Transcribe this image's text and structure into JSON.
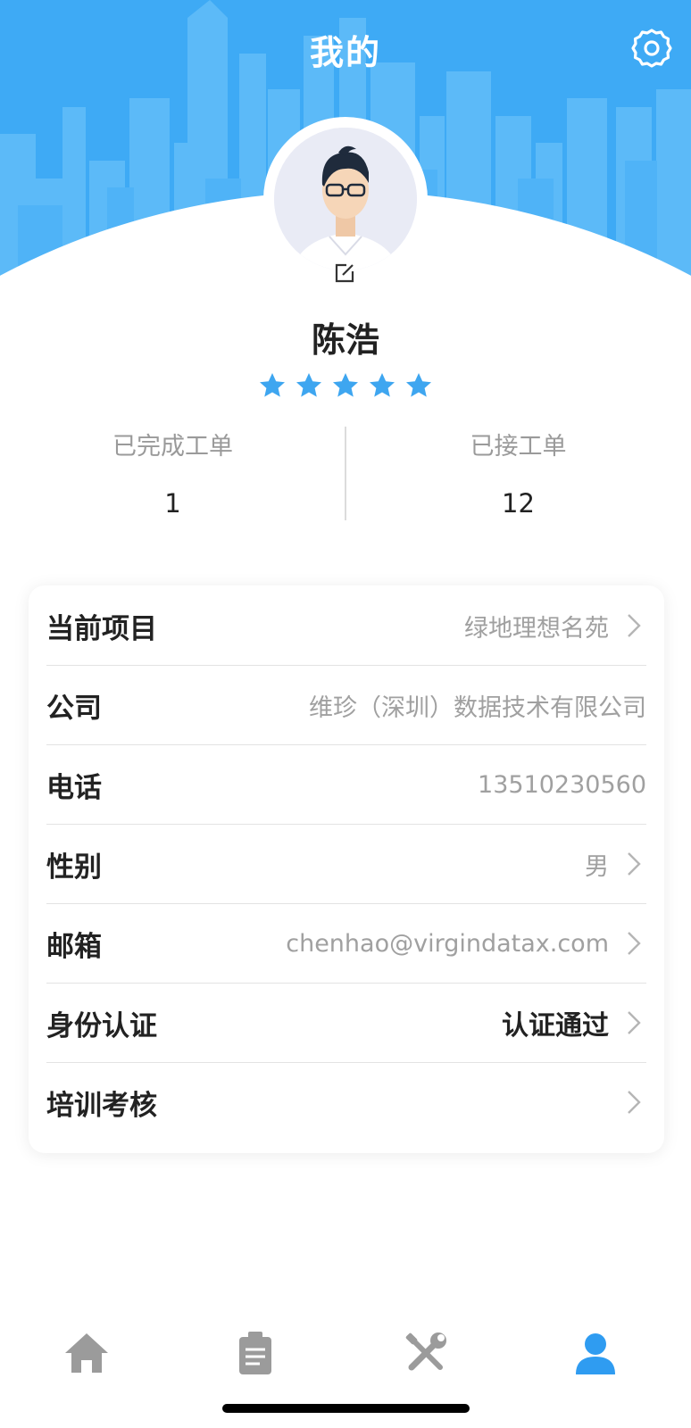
{
  "header": {
    "title": "我的"
  },
  "profile": {
    "name": "陈浩",
    "rating": 5,
    "rating_max": 5
  },
  "stats": [
    {
      "label": "已完成工单",
      "value": "1"
    },
    {
      "label": "已接工单",
      "value": "12"
    }
  ],
  "info_rows": [
    {
      "label": "当前项目",
      "value": "绿地理想名苑"
    },
    {
      "label": "公司",
      "value": "维珍（深圳）数据技术有限公司"
    },
    {
      "label": "电话",
      "value": "13510230560"
    },
    {
      "label": "性别",
      "value": "男"
    },
    {
      "label": "邮箱",
      "value": "chenhao@virgindatax.com"
    },
    {
      "label": "身份认证",
      "value": "认证通过"
    },
    {
      "label": "培训考核",
      "value": ""
    }
  ],
  "tabbar": {
    "items": [
      {
        "icon": "home-icon",
        "active": false
      },
      {
        "icon": "clipboard-icon",
        "active": false
      },
      {
        "icon": "tools-icon",
        "active": false
      },
      {
        "icon": "user-icon",
        "active": true
      }
    ]
  },
  "colors": {
    "brand": "#3eaaf5",
    "star": "#3ea6f0",
    "inactive_tab": "#9b9b9b",
    "active_tab": "#2f9cf1"
  }
}
